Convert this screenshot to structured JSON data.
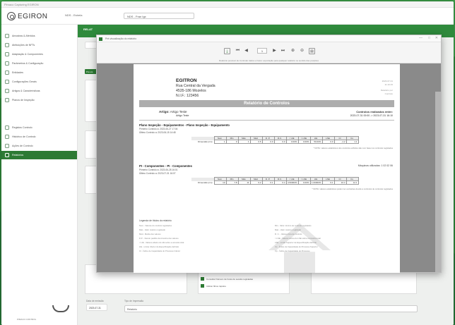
{
  "app": {
    "title_bar": "Pimaco Capturing EGIRON",
    "logo": "EGIRON",
    "top_field_label": "NDS - Estrela",
    "top_select": "NDS - Fran Igx"
  },
  "sidebar": {
    "items": [
      {
        "label": "Amostras & Aferidos",
        "icon": "sample-icon"
      },
      {
        "label": "Atribuições de NFTs",
        "icon": "list-icon"
      },
      {
        "label": "Adaptação & Componentes",
        "icon": "adapter-icon"
      },
      {
        "label": "Parâmetros & Configuração",
        "icon": "settings-icon"
      },
      {
        "label": "Entidades",
        "icon": "entity-icon"
      },
      {
        "label": "Configurações Gerais",
        "icon": "config-icon"
      },
      {
        "label": "Artigos & Características",
        "icon": "article-icon"
      },
      {
        "label": "Planos de Inspeção",
        "icon": "plan-icon"
      },
      {
        "label": "Registos Controlo",
        "icon": "register-icon"
      },
      {
        "label": "Histórico de Controlo",
        "icon": "history-icon"
      },
      {
        "label": "Ações de Controlo",
        "icon": "action-icon"
      },
      {
        "label": "Relatórios",
        "icon": "report-icon"
      }
    ],
    "active_index": 11,
    "footer": "PIMACO CONTROL"
  },
  "background": {
    "header_label": "RELAT",
    "chip": "Pré-vis",
    "check_1": "Consultar Número de horas de sessão registadas",
    "check_2": "Utilizar filtros rápidos",
    "bottom_label_1": "Data de emissão",
    "bottom_value_1": "2023-07-31",
    "bottom_label_2": "Tipo de Impressão",
    "bottom_select": "Relatório"
  },
  "dialog": {
    "title": "Pré-visualização do relatório",
    "toolbar_page": "1",
    "toolbar_hint": "Relatório possível de Controlar dados e Fazer exportação para qualquer relatório no sentido das posições",
    "window_controls": [
      "—",
      "□",
      "✕"
    ]
  },
  "report": {
    "company": "EGITRON",
    "address_1": "Rua Central da Vergada",
    "address_2": "4535-186 Mozelos",
    "nif": "N.I.F.: 123456",
    "top_right_1": "2023-07-31",
    "top_right_2": "11:10:15",
    "top_right_3": "Relatório por",
    "top_right_4": "Controlo",
    "title": "Relatório de Controlos",
    "artigo_label": "Artigo:",
    "artigo_value": "Artigo Teste",
    "artigo_sub": "Artigo Teste",
    "controlos_label": "Controlos realizados entre:",
    "controlos_value": "2023-07-31 00:00 -> 2023-07-31 16:10",
    "sections": [
      {
        "title": "Plano Inspeção - Equipamentos - Plano Inspeção - Equipamento",
        "line_1": "Primeiro Controlo a: 2023-06-27 17:04",
        "line_2": "Último Controlo a: 2023-06-15 14:48",
        "right": "",
        "headers": [
          "Nom",
          "Min",
          "Máx",
          "Méd",
          "D. P.",
          "R.C.",
          "< LIE",
          "> LSE",
          "LIE",
          "LSE",
          "CI",
          "Cs"
        ],
        "row_label": "Dimensão (cm)",
        "values": [
          "1",
          "0",
          "1",
          "0.5",
          "0.0",
          "0.0",
          "0.00%",
          "0.00%",
          "50.00%",
          "0.0",
          "-1.2",
          "1.1"
        ],
        "note": "* NOTA: valores estatísticos dos controlos exibidos são com base nos controlos registados"
      },
      {
        "title": "PI - Componentes - PI - Componentes",
        "line_1": "Primeiro Controlo a: 2023-06-28 16:01",
        "line_2": "Último Controlo a: 2023-07-31 16:07",
        "right": "Máquinas utilizadas: 1 02 02 06",
        "headers": [
          "Nom",
          "Min",
          "Máx",
          "Méd",
          "D. P.",
          "R.C.",
          "< LIE",
          "> LSE",
          "LIE",
          "LSE",
          "CI",
          "Cs"
        ],
        "row_label": "Dimensão (cm)",
        "values": [
          "10",
          "7.8",
          "11",
          "9.2",
          "0.1",
          "0.4",
          "4.50000%",
          "0.00%",
          "1.00000%",
          "9.1",
          "10.4",
          "12.1"
        ],
        "note": "* NOTA: valores estatísticos podem ter exclusões devido a controlos de controlos registados"
      }
    ],
    "legend_title": "Legenda de títulos do relatório",
    "legend_left": [
      "Nom - Valores do controlo registados",
      "Máx - Valor máximo registado",
      "Méd - Média dos valores",
      "D.P. - Desvio padrão da Amostra dos valores",
      "< LIE - Valores abaixo do LIE sobre a amostra total",
      "LIE - Limite Inferior de Especificação definido",
      "CI - Índice de Capacidade do Processo Inferior"
    ],
    "legend_right": [
      "Min - Valor mínimo de controlo registados",
      "Máx - Valor máximo registado",
      "R. C. - Valores fora de controlo",
      "> LSE - Valores acima do LSE sobre a amostra total",
      "LSE - Limite Superior de Especificação definido",
      "Cs - Índice de Capacidade do Processo Superior",
      "Cp - Índice de Capacidade do Processo"
    ]
  }
}
